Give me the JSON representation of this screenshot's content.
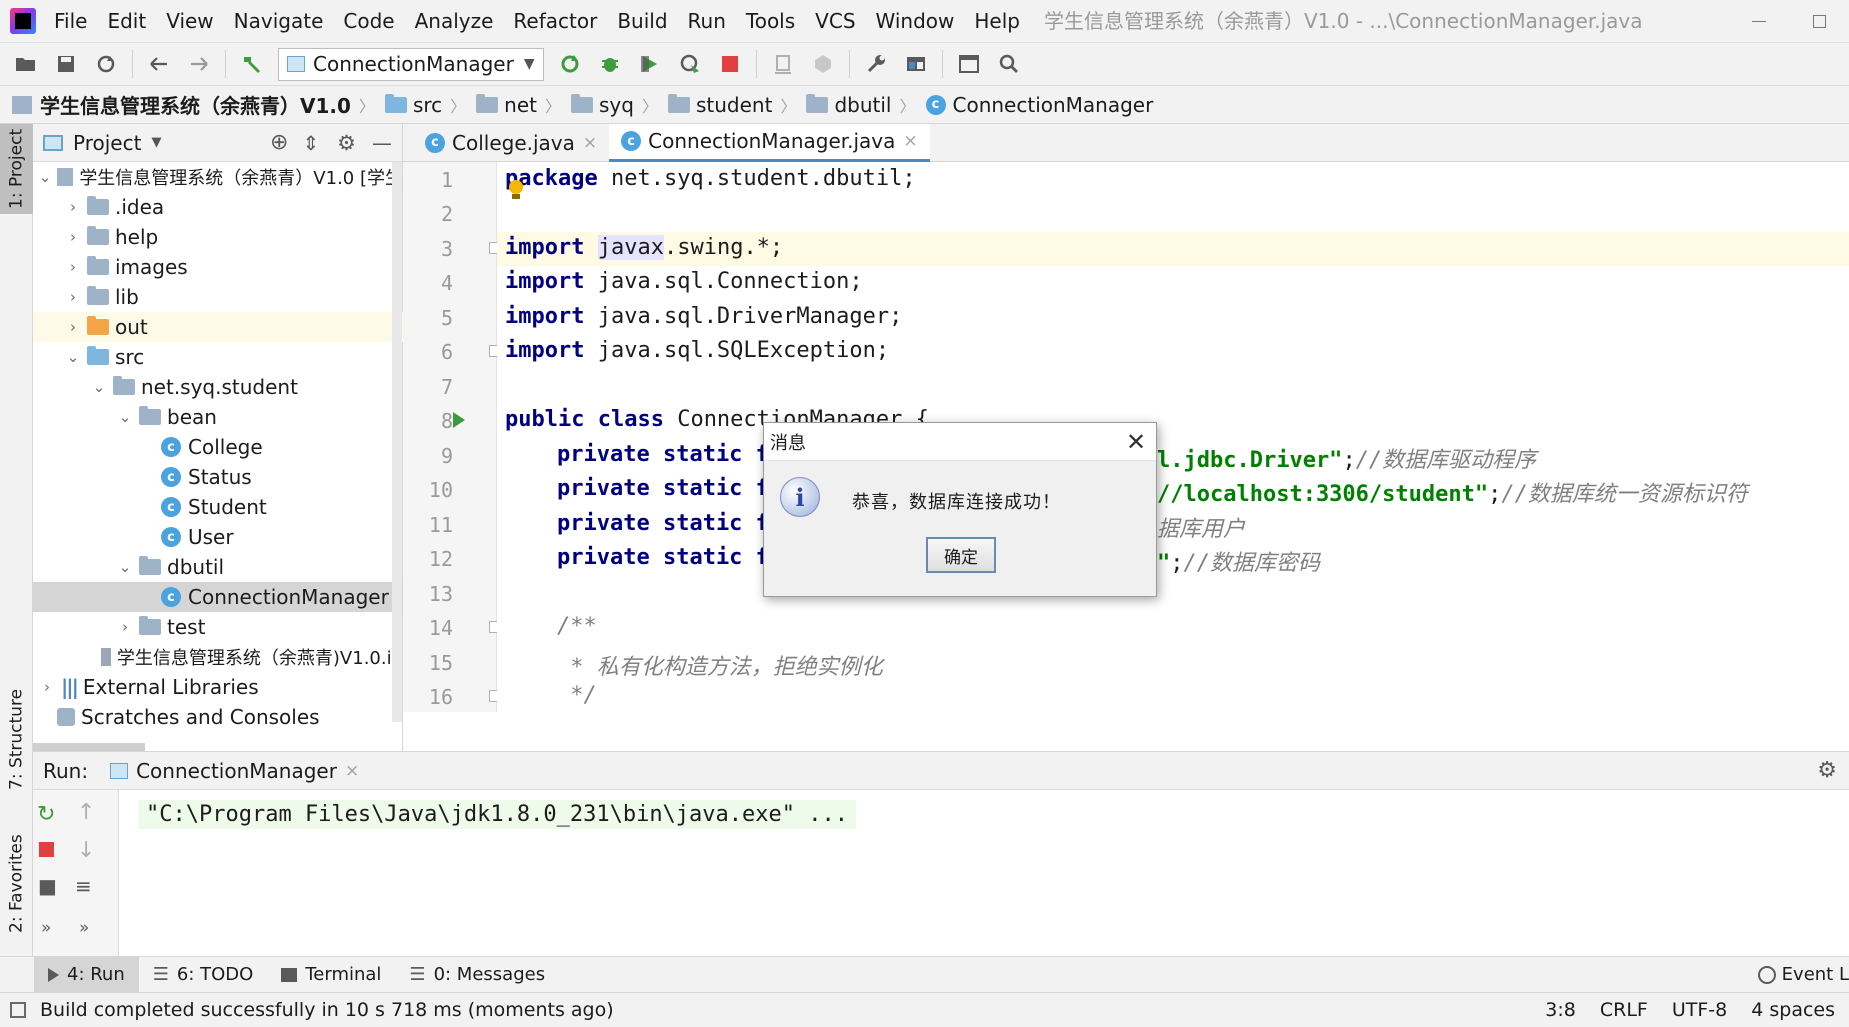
{
  "window": {
    "title": "学生信息管理系统（余燕青）V1.0 - ...\\ConnectionManager.java",
    "menu": [
      "File",
      "Edit",
      "View",
      "Navigate",
      "Code",
      "Analyze",
      "Refactor",
      "Build",
      "Run",
      "Tools",
      "VCS",
      "Window",
      "Help"
    ]
  },
  "toolbar": {
    "run_config": "ConnectionManager"
  },
  "breadcrumb": {
    "project": "学生信息管理系统（余燕青）V1.0",
    "items": [
      "src",
      "net",
      "syq",
      "student",
      "dbutil"
    ],
    "file": "ConnectionManager"
  },
  "side_tabs": {
    "project": "1: Project",
    "structure": "7: Structure",
    "favorites": "2: Favorites"
  },
  "project_panel": {
    "title": "Project",
    "tree": [
      {
        "label": "学生信息管理系统（余燕青）V1.0 [学生",
        "kind": "module"
      },
      {
        "label": ".idea",
        "kind": "folder"
      },
      {
        "label": "help",
        "kind": "folder"
      },
      {
        "label": "images",
        "kind": "folder"
      },
      {
        "label": "lib",
        "kind": "folder"
      },
      {
        "label": "out",
        "kind": "folder-orange"
      },
      {
        "label": "src",
        "kind": "folder-blue"
      },
      {
        "label": "net.syq.student",
        "kind": "package"
      },
      {
        "label": "bean",
        "kind": "package"
      },
      {
        "label": "College",
        "kind": "class"
      },
      {
        "label": "Status",
        "kind": "class"
      },
      {
        "label": "Student",
        "kind": "class"
      },
      {
        "label": "User",
        "kind": "class"
      },
      {
        "label": "dbutil",
        "kind": "package"
      },
      {
        "label": "ConnectionManager",
        "kind": "class-selected"
      },
      {
        "label": "test",
        "kind": "package"
      },
      {
        "label": "学生信息管理系统（余燕青)V1.0.in",
        "kind": "iml"
      },
      {
        "label": "External Libraries",
        "kind": "libs"
      },
      {
        "label": "Scratches and Consoles",
        "kind": "scratch"
      }
    ]
  },
  "editor": {
    "tabs": [
      "College.java",
      "ConnectionManager.java"
    ],
    "line_numbers": [
      "1",
      "2",
      "3",
      "4",
      "5",
      "6",
      "7",
      "8",
      "9",
      "10",
      "11",
      "12",
      "13",
      "14",
      "15",
      "16"
    ],
    "code": {
      "l1_kw": "package",
      "l1_rest": " net.syq.student.dbutil;",
      "l3_kw": "import",
      "l3_a": "javax",
      "l3_b": ".swing.*;",
      "l4_kw": "import",
      "l4_rest": " java.sql.Connection;",
      "l5_kw": "import",
      "l5_rest": " java.sql.DriverManager;",
      "l6_kw": "import",
      "l6_rest": " java.sql.SQLException;",
      "l8_kw": "public class",
      "l8_rest": " ConnectionManager {",
      "l9_kw": "private static f",
      "l9_str": "l.jdbc.Driver\"",
      "l9_semi": ";",
      "l9_cm": "//数据库驱动程序",
      "l10_kw": "private static f",
      "l10_str": "//localhost:3306/student\"",
      "l10_semi": ";",
      "l10_cm": "//数据库统一资源标识符",
      "l11_kw": "private static f",
      "l11_cm": "据库用户",
      "l12_kw": "private static f",
      "l12_str": "\"",
      "l12_semi": ";",
      "l12_cm": "//数据库密码",
      "l14": "/**",
      "l15": " * 私有化构造方法，拒绝实例化",
      "l16": " */"
    }
  },
  "dialog": {
    "title": "消息",
    "message": "恭喜，数据库连接成功！",
    "ok": "确定"
  },
  "run_panel": {
    "label": "Run:",
    "tab": "ConnectionManager",
    "console": "\"C:\\Program Files\\Java\\jdk1.8.0_231\\bin\\java.exe\" ..."
  },
  "bottom_tabs": {
    "run": "4: Run",
    "todo": "6: TODO",
    "terminal": "Terminal",
    "messages": "0: Messages",
    "event": "Event L"
  },
  "status": {
    "message": "Build completed successfully in 10 s 718 ms (moments ago)",
    "position": "3:8",
    "line_sep": "CRLF",
    "encoding": "UTF-8",
    "indent": "4 spaces"
  },
  "colors": {
    "keyword": "#000080",
    "string": "#008000",
    "comment": "#808080",
    "accent": "#4a88c7"
  }
}
